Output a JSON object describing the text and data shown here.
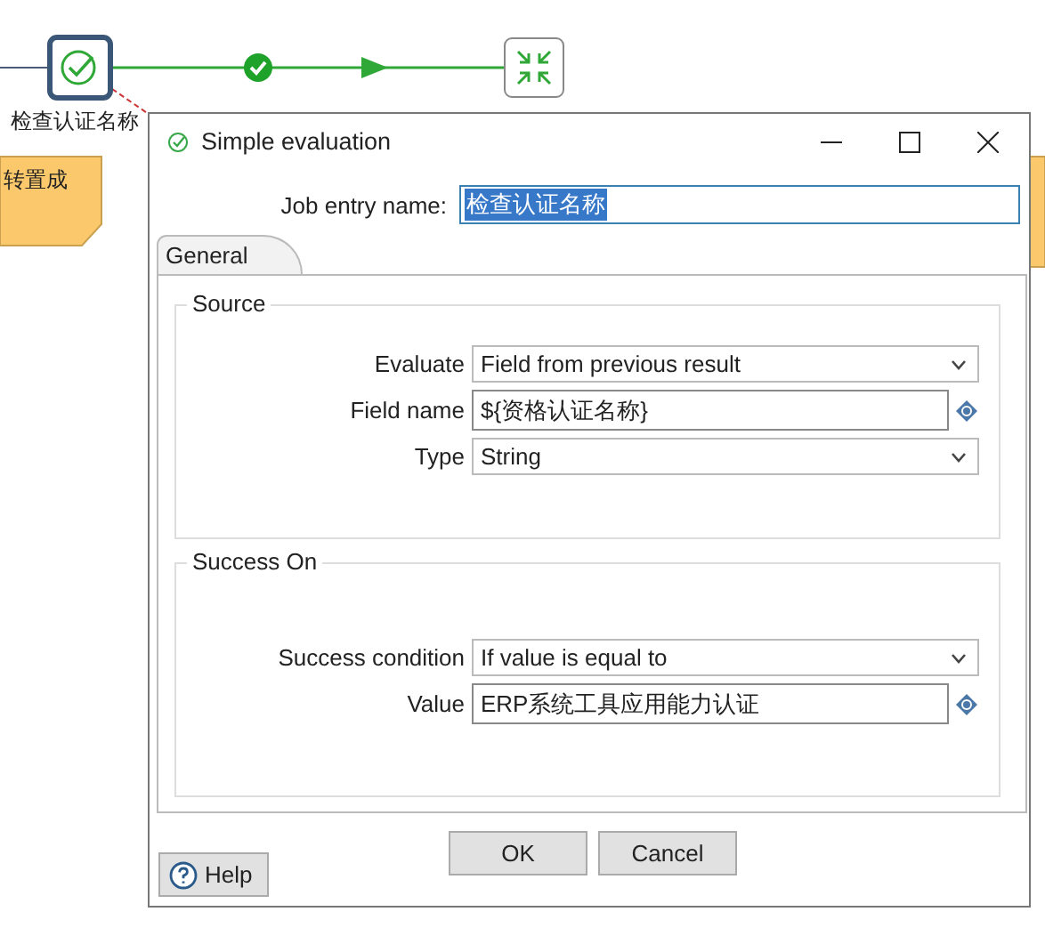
{
  "canvas": {
    "nodes": [
      {
        "kind": "evaluation",
        "label": "检查认证名称",
        "selected": true
      },
      {
        "kind": "end",
        "selected": false
      }
    ],
    "notes": [
      {
        "text": "转置成"
      }
    ]
  },
  "dialog": {
    "title": "Simple evaluation",
    "job_entry_name": {
      "label": "Job entry name:",
      "value": "检查认证名称"
    },
    "tabs": [
      {
        "label": "General",
        "selected": true
      }
    ],
    "groups": [
      {
        "title": "Source",
        "fields": [
          {
            "kind": "dropdown",
            "label": "Evaluate",
            "value": "Field from previous result"
          },
          {
            "kind": "variable",
            "label": "Field name",
            "value": "${资格认证名称}"
          },
          {
            "kind": "dropdown",
            "label": "Type",
            "value": "String"
          }
        ]
      },
      {
        "title": "Success On",
        "fields": [
          {
            "kind": "dropdown",
            "label": "Success condition",
            "value": "If value is equal to"
          },
          {
            "kind": "variable",
            "label": "Value",
            "value": "ERP系统工具应用能力认证"
          }
        ]
      }
    ],
    "buttons": [
      "OK",
      "Cancel"
    ],
    "help": "Help"
  }
}
